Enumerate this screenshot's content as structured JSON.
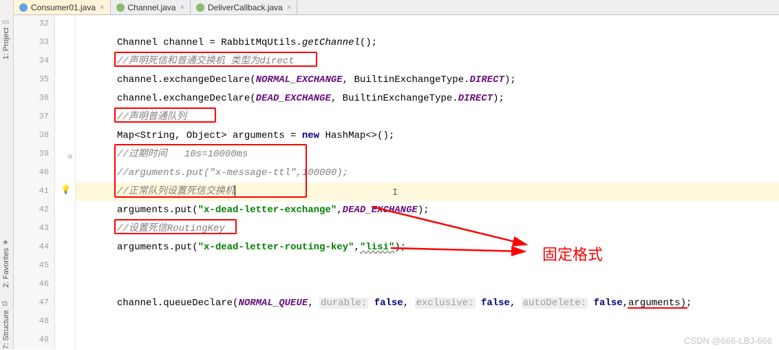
{
  "tabs": [
    {
      "label": "Consumer01.java",
      "iconClass": "c",
      "active": true
    },
    {
      "label": "Channel.java",
      "iconClass": "i",
      "active": false
    },
    {
      "label": "DeliverCallback.java",
      "iconClass": "i",
      "active": false
    }
  ],
  "leftTools": {
    "project": "1: Project",
    "favorites": "2: Favorites",
    "structure": "7: Structure"
  },
  "lineStart": 32,
  "lineEnd": 49,
  "code": {
    "l33_a": "Channel channel = RabbitMqUtils.",
    "l33_b": "getChannel",
    "l33_c": "();",
    "l34": "//声明死信和普通交换机 类型为direct",
    "l35_a": "channel.exchangeDeclare(",
    "l35_b": "NORMAL_EXCHANGE",
    "l35_c": ", BuiltinExchangeType.",
    "l35_d": "DIRECT",
    "l35_e": ");",
    "l36_a": "channel.exchangeDeclare(",
    "l36_b": "DEAD_EXCHANGE",
    "l36_c": ", BuiltinExchangeType.",
    "l36_d": "DIRECT",
    "l36_e": ");",
    "l37": "//声明普通队列",
    "l38_a": "Map<String, Object> arguments = ",
    "l38_b": "new",
    "l38_c": " HashMap<>();",
    "l39": "//过期时间   10s=10000ms",
    "l40": "//arguments.put(\"x-message-ttl\",100000);",
    "l41": "//正常队列设置死信交换机",
    "l42_a": "arguments.put(",
    "l42_b": "\"x-dead-letter-exchange\"",
    "l42_c": ",",
    "l42_d": "DEAD_EXCHANGE",
    "l42_e": ");",
    "l43": "//设置死信RoutingKey",
    "l44_a": "arguments.put(",
    "l44_b": "\"x-dead-letter-routing-key\"",
    "l44_c": ",",
    "l44_d": "\"lisi\"",
    "l44_e": ");",
    "l47_a": "channel.queueDeclare(",
    "l47_b": "NORMAL_QUEUE",
    "l47_c": ", ",
    "l47_h1": "durable:",
    "l47_d": " ",
    "l47_e": "false",
    "l47_f": ", ",
    "l47_h2": "exclusive:",
    "l47_g": " ",
    "l47_i": "false",
    "l47_j": ", ",
    "l47_h3": "autoDelete:",
    "l47_k": " ",
    "l47_l": "false",
    "l47_m": ",arguments);"
  },
  "annotation": "固定格式",
  "watermark": "CSDN @666-LBJ-666"
}
